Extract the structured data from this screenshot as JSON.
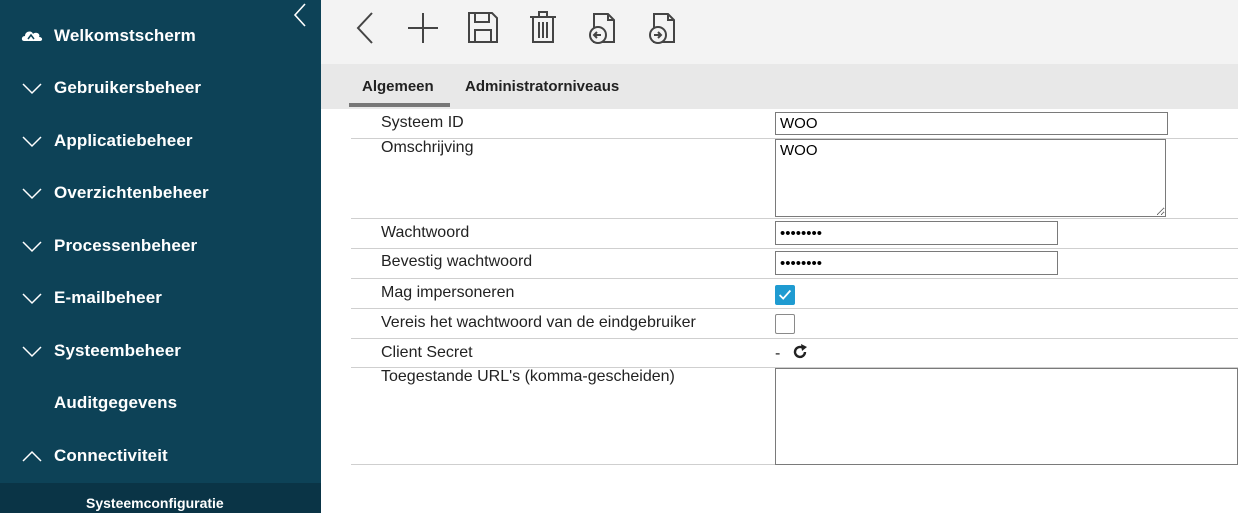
{
  "sidebar": {
    "items": [
      {
        "label": "Welkomstscherm",
        "icon": "cloud-icon"
      },
      {
        "label": "Gebruikersbeheer",
        "icon": "chevron-down-icon"
      },
      {
        "label": "Applicatiebeheer",
        "icon": "chevron-down-icon"
      },
      {
        "label": "Overzichtenbeheer",
        "icon": "chevron-down-icon"
      },
      {
        "label": "Processenbeheer",
        "icon": "chevron-down-icon"
      },
      {
        "label": "E-mailbeheer",
        "icon": "chevron-down-icon"
      },
      {
        "label": "Systeembeheer",
        "icon": "chevron-down-icon"
      },
      {
        "label": "Auditgegevens",
        "icon": ""
      },
      {
        "label": "Connectiviteit",
        "icon": "chevron-up-icon"
      }
    ],
    "subitem": "Systeemconfiguratie"
  },
  "toolbar": {
    "buttons": [
      "back-icon",
      "add-icon",
      "save-icon",
      "delete-icon",
      "import-icon",
      "export-icon"
    ]
  },
  "tabs": {
    "general": "Algemeen",
    "admin_levels": "Administratorniveaus",
    "active": "Algemeen"
  },
  "form": {
    "system_id": {
      "label": "Systeem ID",
      "value": "WOO"
    },
    "description": {
      "label": "Omschrijving",
      "value": "WOO"
    },
    "password": {
      "label": "Wachtwoord",
      "value": "••••••••"
    },
    "confirm_password": {
      "label": "Bevestig wachtwoord",
      "value": "••••••••"
    },
    "may_impersonate": {
      "label": "Mag impersoneren",
      "checked": true
    },
    "require_user_password": {
      "label": "Vereis het wachtwoord van de eindgebruiker",
      "checked": false
    },
    "client_secret": {
      "label": "Client Secret",
      "value": "-"
    },
    "allowed_urls": {
      "label": "Toegestande URL's (komma-gescheiden)",
      "value": ""
    }
  },
  "colors": {
    "sidebar_bg": "#0d4257",
    "checkbox_accent": "#1f9bd1"
  }
}
